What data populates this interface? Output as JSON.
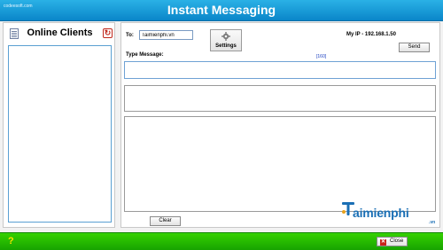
{
  "titlebar": {
    "brand": "codeesoft.com",
    "title": "Instant Messaging"
  },
  "sidebar": {
    "title": "Online Clients",
    "clients": []
  },
  "compose": {
    "to_label": "To:",
    "to_value": "Taimienphi.vn",
    "settings_label": "Settings",
    "ip_label": "My IP - 192.168.1.50",
    "send_label": "Send",
    "type_message_label": "Type Message:",
    "char_count": "[160]",
    "message_value": "",
    "clear_label": "Clear"
  },
  "watermark": {
    "name": "aimienphi",
    "tld": ".vn"
  },
  "footer": {
    "help_glyph": "?",
    "close_label": "Close"
  },
  "colors": {
    "titlebar": "#0a86c9",
    "footer": "#17a300",
    "input_border": "#6fa2d4"
  }
}
